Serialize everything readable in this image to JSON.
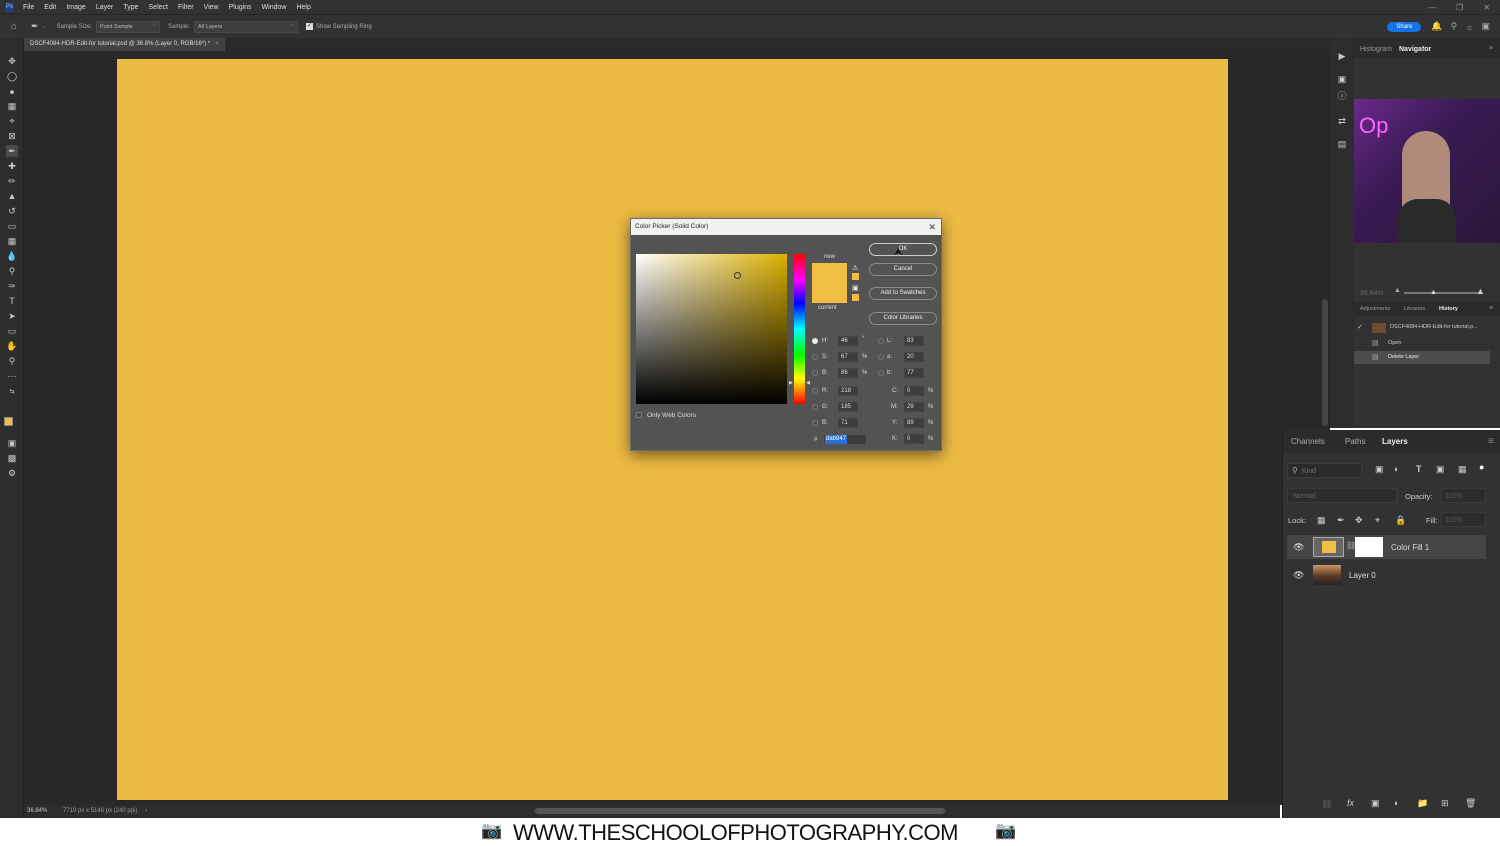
{
  "menu": {
    "items": [
      "File",
      "Edit",
      "Image",
      "Layer",
      "Type",
      "Select",
      "Filter",
      "View",
      "Plugins",
      "Window",
      "Help"
    ]
  },
  "options": {
    "sample_size_label": "Sample Size:",
    "sample_size_value": "Point Sample",
    "sample_label": "Sample:",
    "sample_value": "All Layers",
    "show_ring_label": "Show Sampling Ring",
    "share": "Share"
  },
  "document": {
    "tab_title": "DSCF4084-HDR-Edit-for tutorial.psd @ 36.8% (Layer 0, RGB/16*) *",
    "zoom": "36.84%",
    "dimensions": "7719 px x 5146 px (240 ppi)"
  },
  "canvas": {
    "fill_color": "#ecbb43"
  },
  "dialog": {
    "title": "Color Picker (Solid Color)",
    "ok": "OK",
    "cancel": "Cancel",
    "add_to_swatches": "Add to Swatches",
    "color_libraries": "Color Libraries",
    "new_label": "new",
    "current_label": "current",
    "only_web_colors": "Only Web Colors",
    "hsb": {
      "H": "46",
      "S": "67",
      "B": "86"
    },
    "rgb": {
      "R": "218",
      "G": "185",
      "B": "71"
    },
    "lab": {
      "L": "83",
      "a": "20",
      "b": "77"
    },
    "cmyk": {
      "C": "0",
      "M": "29",
      "Y": "89",
      "K": "0"
    },
    "hex": "dab947",
    "swatch_color": "#f1bd45"
  },
  "panels": {
    "top_tabs": [
      "Histogram",
      "Navigator"
    ],
    "nav_zoom": "36.84%",
    "mid_tabs": [
      "Adjustments",
      "Libraries",
      "History"
    ],
    "history": [
      "DSCF4084-HDR-Edit-for tutorial.p...",
      "Open",
      "Delete Layer"
    ],
    "layers_tabs": [
      "Channels",
      "Paths",
      "Layers"
    ],
    "kind_placeholder": "Kind",
    "blend_mode": "Normal",
    "opacity_label": "Opacity:",
    "opacity_value": "100%",
    "lock_label": "Lock:",
    "fill_label": "Fill:",
    "fill_value": "100%",
    "layers": [
      "Color Fill 1",
      "Layer 0"
    ]
  },
  "footer": {
    "url": "WWW.THESCHOOLOFPHOTOGRAPHY.COM"
  }
}
